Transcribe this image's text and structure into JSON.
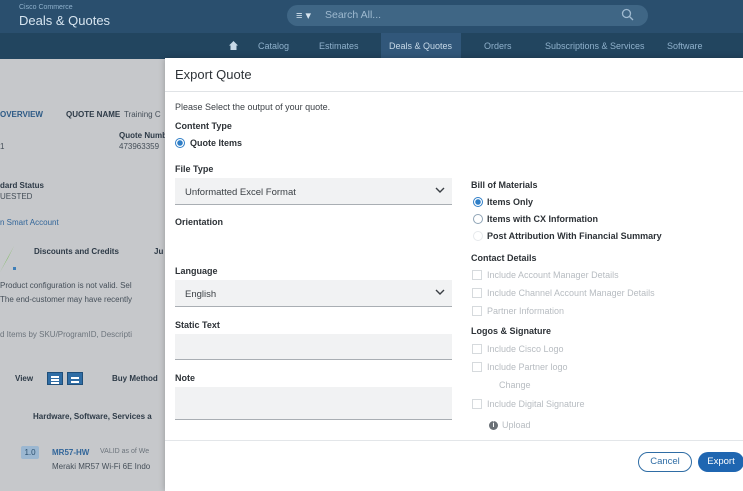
{
  "header": {
    "brand_small": "Cisco Commerce",
    "brand": "Deals & Quotes",
    "search_menu": "≡ ▾",
    "search_placeholder": "Search All..."
  },
  "nav": {
    "items": [
      "Catalog",
      "Estimates",
      "Deals & Quotes",
      "Orders",
      "Subscriptions & Services",
      "Software"
    ]
  },
  "background": {
    "overview": "OVERVIEW",
    "quote_name_label": "QUOTE NAME",
    "quote_name_value": "Training C",
    "quote_number_label": "Quote Numb",
    "quote_number_value": "473963359",
    "left_digit": "1",
    "status_label": "dard Status",
    "status_value": "UESTED",
    "smart_account": "n Smart Account",
    "tab_discounts": "Discounts and Credits",
    "tab_ju": "Ju",
    "msg1": "Product configuration is not valid. Sel",
    "msg2": "The end-customer may have recently",
    "filter": "d Items by SKU/ProgramID, Descripti",
    "view_label": "View",
    "buy_method": "Buy Method",
    "section": "Hardware, Software, Services a",
    "row_number": "1.0",
    "row_sku": "MR57-HW",
    "row_valid": "VALID as of We",
    "row_desc": "Meraki MR57 Wi-Fi 6E Indo"
  },
  "modal": {
    "title": "Export Quote",
    "intro": "Please Select the output of your quote.",
    "content_type_label": "Content Type",
    "content_type_option": "Quote Items",
    "file_type_label": "File Type",
    "file_type_value": "Unformatted Excel Format",
    "orientation_label": "Orientation",
    "language_label": "Language",
    "language_value": "English",
    "static_text_label": "Static Text",
    "note_label": "Note",
    "bom_label": "Bill of Materials",
    "bom_options": [
      "Items Only",
      "Items with CX Information",
      "Post Attribution With Financial Summary"
    ],
    "contact_label": "Contact Details",
    "contact_options": [
      "Include Account Manager Details",
      "Include Channel Account Manager Details",
      "Partner Information"
    ],
    "logos_label": "Logos & Signature",
    "logo_options": [
      "Include Cisco Logo",
      "Include Partner logo"
    ],
    "change_label": "Change",
    "signature_option": "Include Digital Signature",
    "upload_label": "Upload",
    "cancel_label": "Cancel",
    "export_label": "Export"
  },
  "colors": {
    "header_bg": "#2a4f6e",
    "nav_bg": "#22455f",
    "primary": "#1f66b1",
    "radio_selected": "#2f7ec7"
  },
  "icons": {
    "search": "magnifier-icon",
    "home": "home-icon",
    "chevron": "chevron-down-icon",
    "portrait": "portrait-orientation-icon",
    "landscape": "landscape-orientation-icon",
    "info": "info-icon",
    "arrow": "green-arrow-icon"
  }
}
